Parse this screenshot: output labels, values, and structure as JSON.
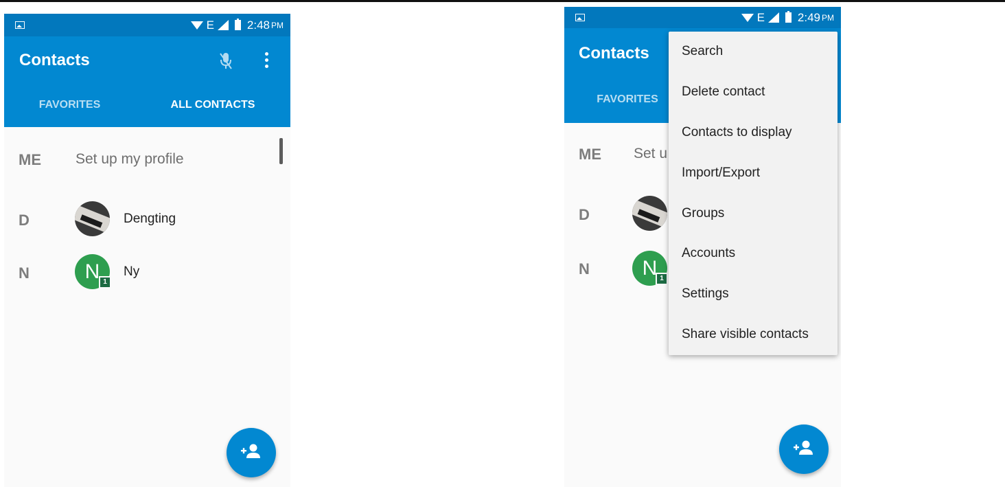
{
  "left_screen": {
    "status_bar": {
      "network": "E",
      "time": "2:48",
      "ampm": "PM"
    },
    "app_bar": {
      "title": "Contacts"
    },
    "tabs": [
      {
        "label": "FAVORITES"
      },
      {
        "label": "ALL CONTACTS"
      }
    ],
    "me_row": {
      "letter": "ME",
      "text": "Set up my profile"
    },
    "contacts": [
      {
        "section": "D",
        "name": "Dengting"
      },
      {
        "section": "N",
        "name": "Ny",
        "avatar_letter": "N",
        "badge": "1"
      }
    ]
  },
  "right_screen": {
    "status_bar": {
      "network": "E",
      "time": "2:49",
      "ampm": "PM"
    },
    "app_bar": {
      "title": "Contacts"
    },
    "tabs": [
      {
        "label": "FAVORITES"
      }
    ],
    "me_row": {
      "letter": "ME",
      "text": "Set u"
    },
    "contacts": [
      {
        "section": "D"
      },
      {
        "section": "N",
        "avatar_letter": "N",
        "badge": "1"
      }
    ],
    "overflow_menu": {
      "items": [
        {
          "label": "Search"
        },
        {
          "label": "Delete contact"
        },
        {
          "label": "Contacts to display"
        },
        {
          "label": "Import/Export"
        },
        {
          "label": "Groups"
        },
        {
          "label": "Accounts"
        },
        {
          "label": "Settings"
        },
        {
          "label": "Share visible contacts"
        }
      ]
    }
  },
  "colors": {
    "status_bar": "#0278bd",
    "app_bar": "#0288d1",
    "fab": "#0288d1",
    "avatar_green": "#2e9e4f",
    "background": "#fafafa"
  },
  "icons": [
    "image-notification-icon",
    "wifi-icon",
    "signal-icon",
    "battery-charging-icon",
    "mic-off-icon",
    "more-vert-icon",
    "add-contact-icon"
  ]
}
